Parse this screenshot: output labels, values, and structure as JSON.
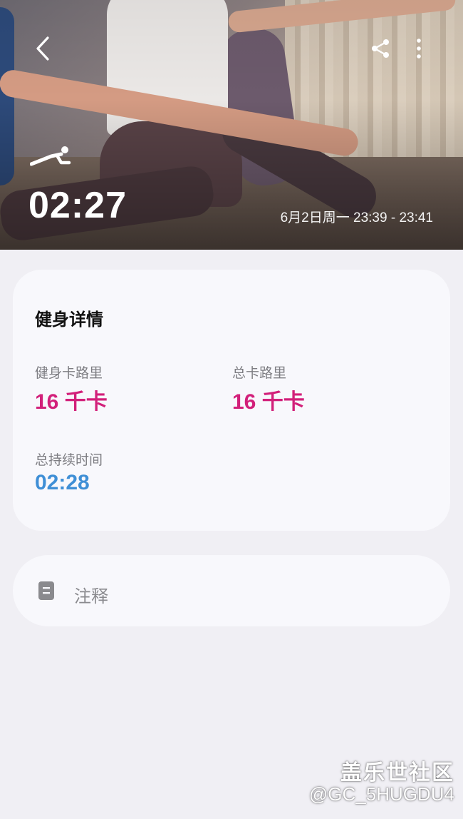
{
  "hero": {
    "duration": "02:27",
    "date_range": "6月2日周一 23:39 - 23:41",
    "workout_icon": "plank-exercise-icon"
  },
  "toolbar": {
    "back_icon": "chevron-left-icon",
    "share_icon": "share-icon",
    "more_icon": "more-vertical-icon"
  },
  "details": {
    "title": "健身详情",
    "metrics": [
      {
        "label": "健身卡路里",
        "value": "16 千卡",
        "color": "#d2207a"
      },
      {
        "label": "总卡路里",
        "value": "16 千卡",
        "color": "#d2207a"
      },
      {
        "label": "总持续时间",
        "value": "02:28",
        "color": "#3f8fd6"
      }
    ]
  },
  "notes": {
    "label": "注释",
    "icon": "note-icon"
  },
  "watermark": {
    "title": "盖乐世社区",
    "handle": "@GC_5HUGDU4"
  }
}
